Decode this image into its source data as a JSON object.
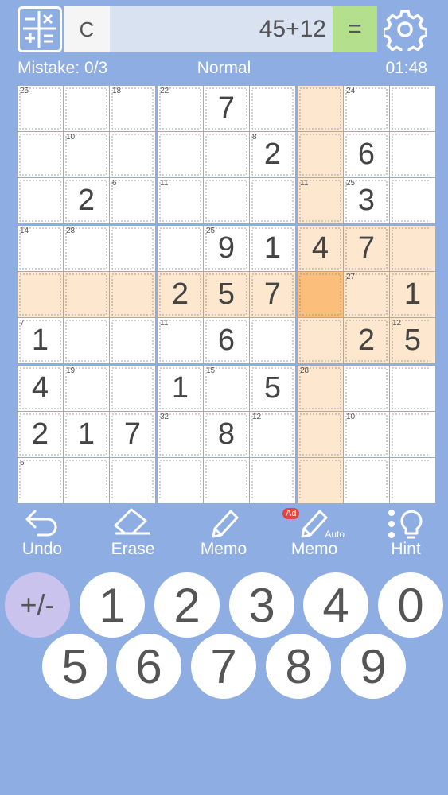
{
  "topbar": {
    "calc_icon": "calculator-icon",
    "clear_label": "C",
    "expression": "45+12",
    "equals_label": "=",
    "settings_icon": "gear-icon"
  },
  "status": {
    "mistake": "Mistake: 0/3",
    "level": "Normal",
    "time": "01:48"
  },
  "board": {
    "cage_sums": [
      {
        "r": 0,
        "c": 0,
        "v": "25"
      },
      {
        "r": 0,
        "c": 2,
        "v": "18"
      },
      {
        "r": 0,
        "c": 3,
        "v": "22"
      },
      {
        "r": 0,
        "c": 7,
        "v": "24"
      },
      {
        "r": 1,
        "c": 1,
        "v": "10"
      },
      {
        "r": 1,
        "c": 5,
        "v": "8"
      },
      {
        "r": 2,
        "c": 2,
        "v": "6"
      },
      {
        "r": 2,
        "c": 3,
        "v": "11"
      },
      {
        "r": 2,
        "c": 6,
        "v": "11"
      },
      {
        "r": 2,
        "c": 7,
        "v": "25"
      },
      {
        "r": 3,
        "c": 0,
        "v": "14"
      },
      {
        "r": 3,
        "c": 1,
        "v": "28"
      },
      {
        "r": 3,
        "c": 4,
        "v": "25"
      },
      {
        "r": 4,
        "c": 7,
        "v": "27"
      },
      {
        "r": 5,
        "c": 0,
        "v": "7"
      },
      {
        "r": 5,
        "c": 3,
        "v": "11"
      },
      {
        "r": 5,
        "c": 8,
        "v": "12"
      },
      {
        "r": 6,
        "c": 1,
        "v": "19"
      },
      {
        "r": 6,
        "c": 4,
        "v": "15"
      },
      {
        "r": 6,
        "c": 6,
        "v": "28"
      },
      {
        "r": 7,
        "c": 3,
        "v": "32"
      },
      {
        "r": 7,
        "c": 5,
        "v": "12"
      },
      {
        "r": 7,
        "c": 7,
        "v": "10"
      },
      {
        "r": 8,
        "c": 0,
        "v": "5"
      }
    ],
    "digits": [
      {
        "r": 0,
        "c": 4,
        "v": "7"
      },
      {
        "r": 1,
        "c": 5,
        "v": "2"
      },
      {
        "r": 1,
        "c": 7,
        "v": "6"
      },
      {
        "r": 2,
        "c": 1,
        "v": "2"
      },
      {
        "r": 2,
        "c": 7,
        "v": "3"
      },
      {
        "r": 3,
        "c": 4,
        "v": "9"
      },
      {
        "r": 3,
        "c": 5,
        "v": "1"
      },
      {
        "r": 3,
        "c": 6,
        "v": "4"
      },
      {
        "r": 3,
        "c": 7,
        "v": "7"
      },
      {
        "r": 4,
        "c": 3,
        "v": "2"
      },
      {
        "r": 4,
        "c": 4,
        "v": "5"
      },
      {
        "r": 4,
        "c": 5,
        "v": "7"
      },
      {
        "r": 4,
        "c": 8,
        "v": "1"
      },
      {
        "r": 5,
        "c": 0,
        "v": "1"
      },
      {
        "r": 5,
        "c": 4,
        "v": "6"
      },
      {
        "r": 5,
        "c": 7,
        "v": "2"
      },
      {
        "r": 5,
        "c": 8,
        "v": "5"
      },
      {
        "r": 6,
        "c": 0,
        "v": "4"
      },
      {
        "r": 6,
        "c": 3,
        "v": "1"
      },
      {
        "r": 6,
        "c": 5,
        "v": "5"
      },
      {
        "r": 7,
        "c": 0,
        "v": "2"
      },
      {
        "r": 7,
        "c": 1,
        "v": "1"
      },
      {
        "r": 7,
        "c": 2,
        "v": "7"
      },
      {
        "r": 7,
        "c": 4,
        "v": "8"
      }
    ],
    "selected": {
      "r": 4,
      "c": 6
    },
    "colors": {
      "highlight": "#fde7cf",
      "selected": "#fbbf7b",
      "cell": "#ffffff",
      "grid": "#8eaee3"
    }
  },
  "toolbar": [
    {
      "id": "undo",
      "label": "Undo",
      "icon": "undo-icon"
    },
    {
      "id": "erase",
      "label": "Erase",
      "icon": "eraser-icon"
    },
    {
      "id": "memo",
      "label": "Memo",
      "icon": "pencil-icon"
    },
    {
      "id": "auto-memo",
      "label": "Memo",
      "icon": "auto-pencil-icon",
      "badge": "Ad",
      "sub": "Auto"
    },
    {
      "id": "hint",
      "label": "Hint",
      "icon": "lightbulb-icon"
    }
  ],
  "keypad": {
    "sign": "+/-",
    "row1": [
      "1",
      "2",
      "3",
      "4",
      "0"
    ],
    "row2": [
      "5",
      "6",
      "7",
      "8",
      "9"
    ]
  }
}
